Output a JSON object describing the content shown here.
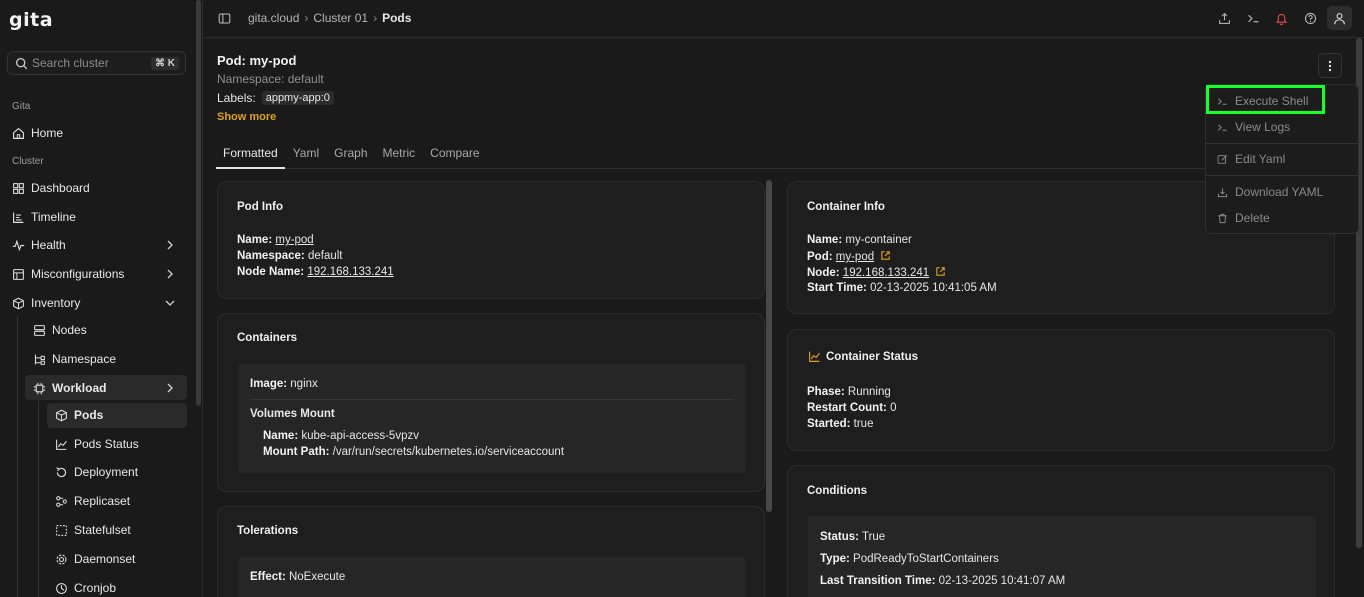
{
  "app": {
    "logo": "gita"
  },
  "search": {
    "placeholder": "Search cluster",
    "shortcut": "⌘ K"
  },
  "sidebar": {
    "section_gita": "Gita",
    "section_cluster": "Cluster",
    "items": {
      "home": "Home",
      "dashboard": "Dashboard",
      "timeline": "Timeline",
      "health": "Health",
      "misconfigurations": "Misconfigurations",
      "inventory": "Inventory",
      "nodes": "Nodes",
      "namespace": "Namespace",
      "workload": "Workload",
      "pods": "Pods",
      "pods_status": "Pods Status",
      "deployment": "Deployment",
      "replicaset": "Replicaset",
      "statefulset": "Statefulset",
      "daemonset": "Daemonset",
      "cronjob": "Cronjob"
    }
  },
  "breadcrumb": {
    "root": "gita.cloud",
    "cluster": "Cluster 01",
    "current": "Pods"
  },
  "pod": {
    "title": "Pod: my-pod",
    "namespace": "Namespace: default",
    "labels_label": "Labels:",
    "label_chip": "appmy-app:0",
    "show_more": "Show more"
  },
  "tabs": [
    "Formatted",
    "Yaml",
    "Graph",
    "Metric",
    "Compare"
  ],
  "pod_info": {
    "title": "Pod Info",
    "name_key": "Name:",
    "name_val": "my-pod",
    "namespace_key": "Namespace:",
    "namespace_val": "default",
    "node_key": "Node Name:",
    "node_val": "192.168.133.241"
  },
  "containers": {
    "title": "Containers",
    "image_key": "Image:",
    "image_val": "nginx",
    "volumes_title": "Volumes Mount",
    "vname_key": "Name:",
    "vname_val": "kube-api-access-5vpzv",
    "mount_key": "Mount Path:",
    "mount_val": "/var/run/secrets/kubernetes.io/serviceaccount"
  },
  "tolerations": {
    "title": "Tolerations",
    "effect_key": "Effect:",
    "effect_val": "NoExecute"
  },
  "container_info": {
    "title": "Container Info",
    "name_key": "Name:",
    "name_val": "my-container",
    "pod_key": "Pod:",
    "pod_val": "my-pod",
    "node_key": "Node:",
    "node_val": "192.168.133.241",
    "start_key": "Start Time:",
    "start_val": "02-13-2025 10:41:05 AM"
  },
  "container_status": {
    "title": "Container Status",
    "phase_key": "Phase:",
    "phase_val": "Running",
    "restart_key": "Restart Count:",
    "restart_val": "0",
    "started_key": "Started:",
    "started_val": "true"
  },
  "conditions": {
    "title": "Conditions",
    "status_key": "Status:",
    "status_val": "True",
    "type_key": "Type:",
    "type_val": "PodReadyToStartContainers",
    "ltt_key": "Last Transition Time:",
    "ltt_val": "02-13-2025 10:41:07 AM"
  },
  "menu": {
    "execute_shell": "Execute Shell",
    "view_logs": "View Logs",
    "edit_yaml": "Edit Yaml",
    "download_yaml": "Download YAML",
    "delete": "Delete"
  },
  "colors": {
    "accent": "#e0a11b",
    "highlight": "#17ff2b",
    "notification": "#e5484d"
  }
}
